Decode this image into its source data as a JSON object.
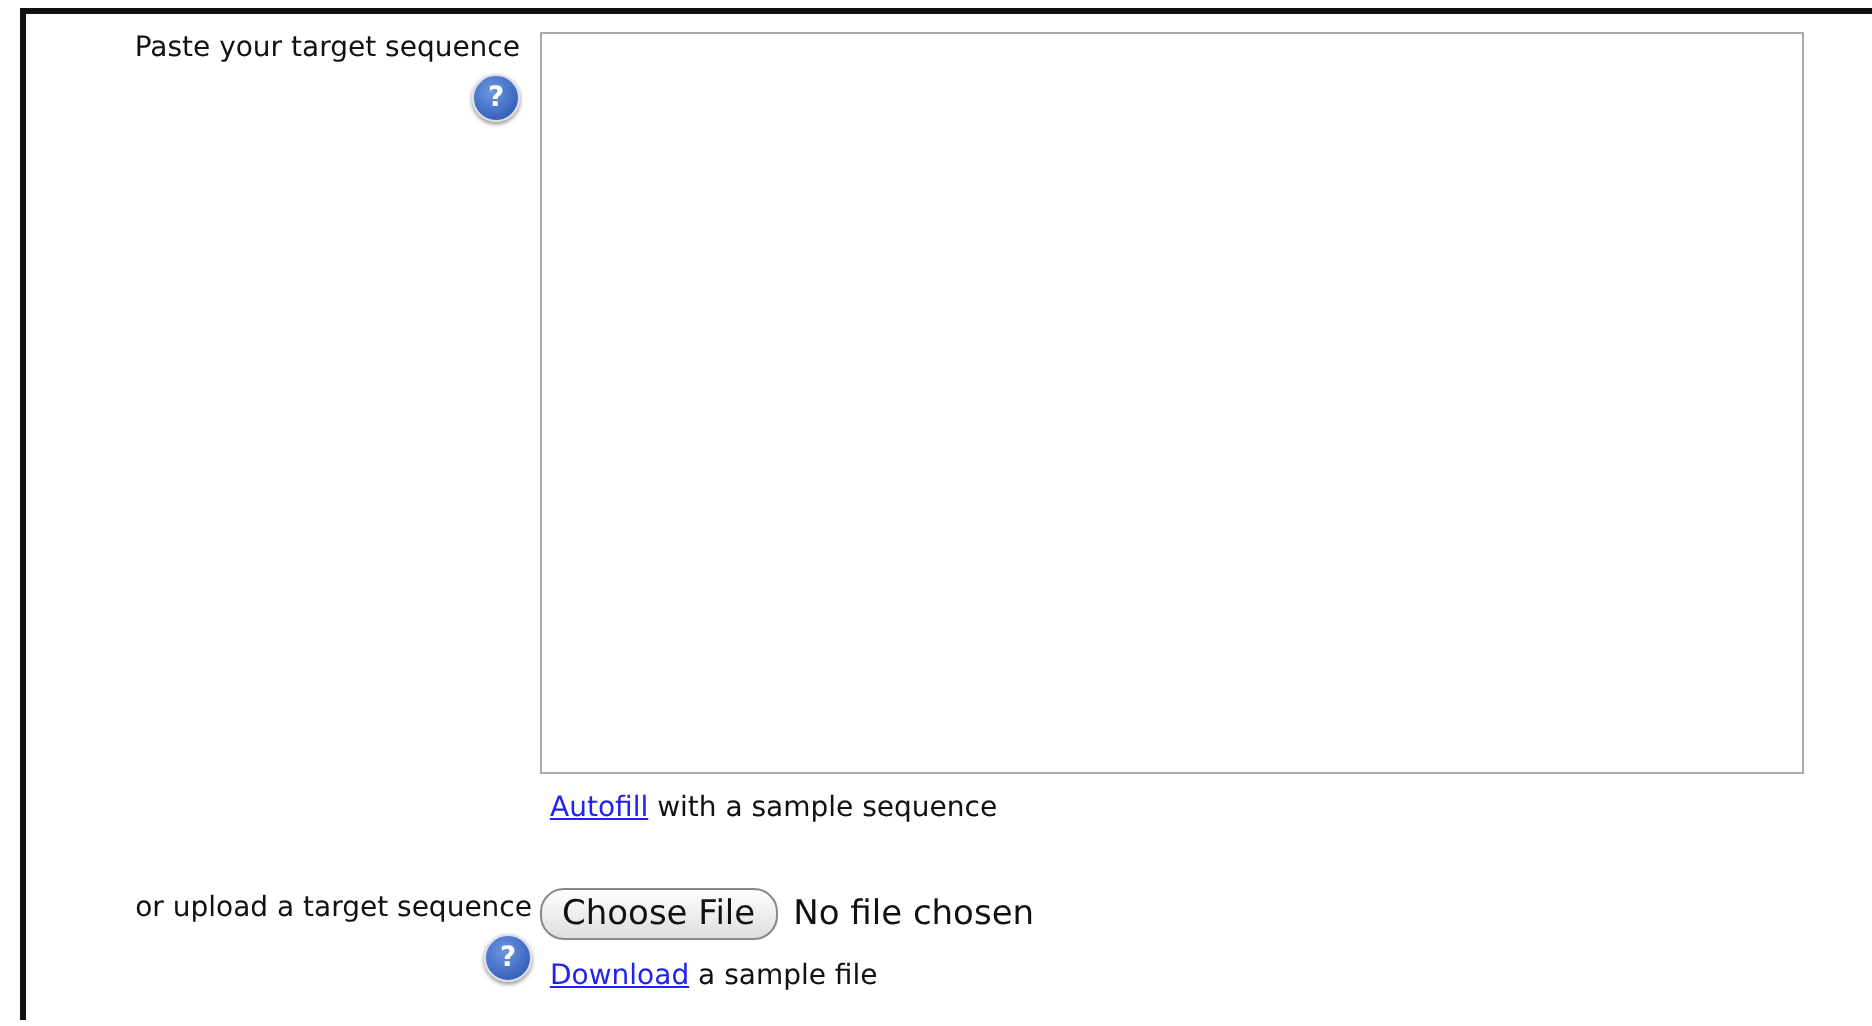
{
  "sequence_input": {
    "label": "Paste your target sequence",
    "help_icon": "?",
    "link": "Autofill",
    "link_suffix": "with a sample sequence"
  },
  "upload": {
    "label": "or upload a target sequence",
    "help_icon": "?",
    "button": "Choose File",
    "status": "No file chosen",
    "link": "Download",
    "link_suffix": "a sample file"
  }
}
